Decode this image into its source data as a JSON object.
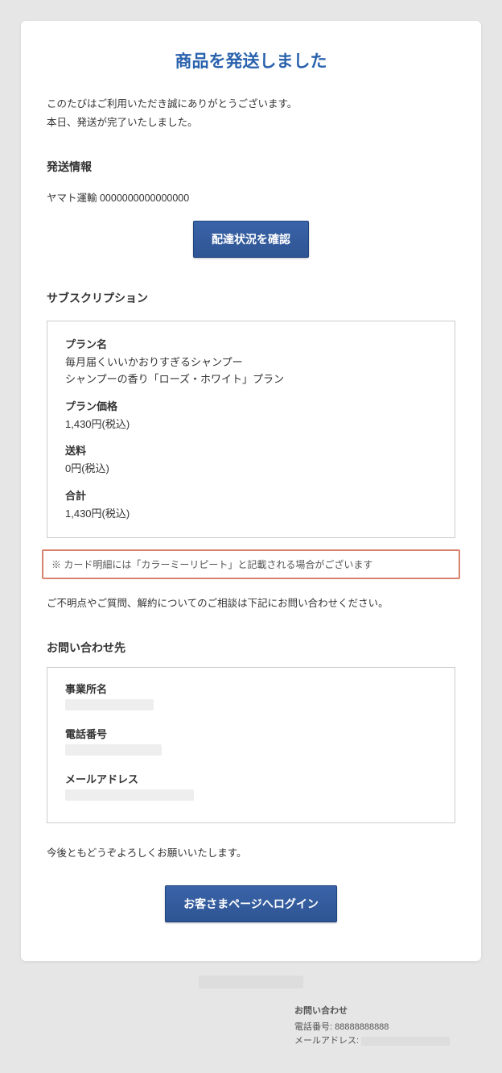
{
  "title": "商品を発送しました",
  "intro_line1": "このたびはご利用いただき誠にありがとうございます。",
  "intro_line2": "本日、発送が完了いたしました。",
  "shipping_heading": "発送情報",
  "shipping_line": "ヤマト運輸 0000000000000000",
  "track_button": "配達状況を確認",
  "subscription_heading": "サブスクリプション",
  "sub": {
    "plan_label": "プラン名",
    "plan_val1": "毎月届くいいかおりすぎるシャンプー",
    "plan_val2": "シャンプーの香り「ローズ・ホワイト」プラン",
    "price_label": "プラン価格",
    "price_val": "1,430円(税込)",
    "ship_label": "送料",
    "ship_val": "0円(税込)",
    "total_label": "合計",
    "total_val": "1,430円(税込)"
  },
  "card_notice": "※ カード明細には「カラーミーリピート」と記載される場合がございます",
  "support_note": "ご不明点やご質問、解約についてのご相談は下記にお問い合わせください。",
  "contact_heading": "お問い合わせ先",
  "contact": {
    "company_label": "事業所名",
    "phone_label": "電話番号",
    "email_label": "メールアドレス"
  },
  "closing": "今後ともどうぞよろしくお願いいたします。",
  "login_button": "お客さまページへログイン",
  "footer": {
    "contact_heading": "お問い合わせ",
    "phone_label": "電話番号: ",
    "phone_value": "88888888888",
    "email_label": "メールアドレス: "
  }
}
